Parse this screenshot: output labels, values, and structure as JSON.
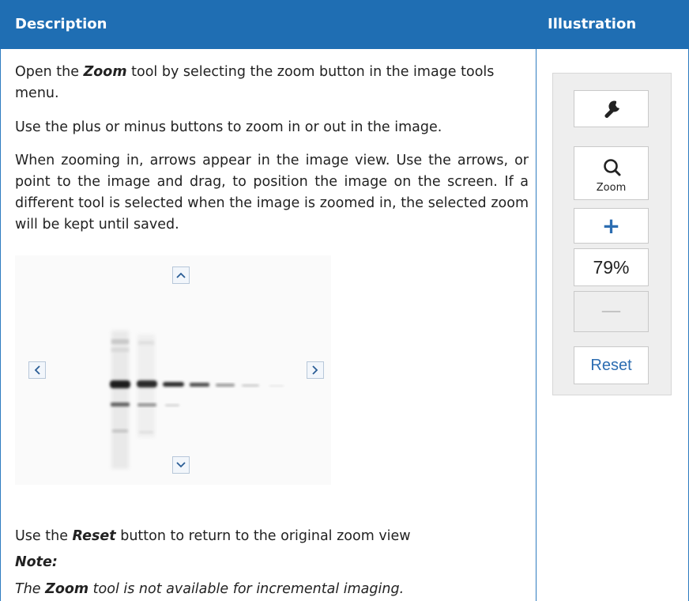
{
  "header": {
    "description": "Description",
    "illustration": "Illustration"
  },
  "paragraphs": {
    "p1_pre": "Open the ",
    "p1_tool": "Zoom",
    "p1_post": " tool by selecting the zoom button in the image tools menu.",
    "p2": "Use the plus or minus buttons to zoom in or out in the image.",
    "p3": "When zooming in, arrows appear in the image view. Use the arrows, or point to the image and drag, to position the image on the screen. If a different tool is selected when the image is zoomed in, the selected zoom will be kept until saved.",
    "p4_pre": "Use the ",
    "p4_button": "Reset",
    "p4_post": " button to return to the original zoom view"
  },
  "note": {
    "label": "Note:",
    "pre": "The ",
    "tool": "Zoom",
    "post": " tool is not available for incremental imaging."
  },
  "panel": {
    "zoom_label": "Zoom",
    "plus_label": "+",
    "zoom_level": "79%",
    "minus_label": "—",
    "reset_label": "Reset"
  },
  "icons": {
    "wrench": "wrench-icon",
    "magnifier": "search-icon",
    "up": "chevron-up-icon",
    "down": "chevron-down-icon",
    "left": "chevron-left-icon",
    "right": "chevron-right-icon"
  },
  "colors": {
    "header_bg": "#1f6eb3",
    "accent": "#2c6db1"
  }
}
